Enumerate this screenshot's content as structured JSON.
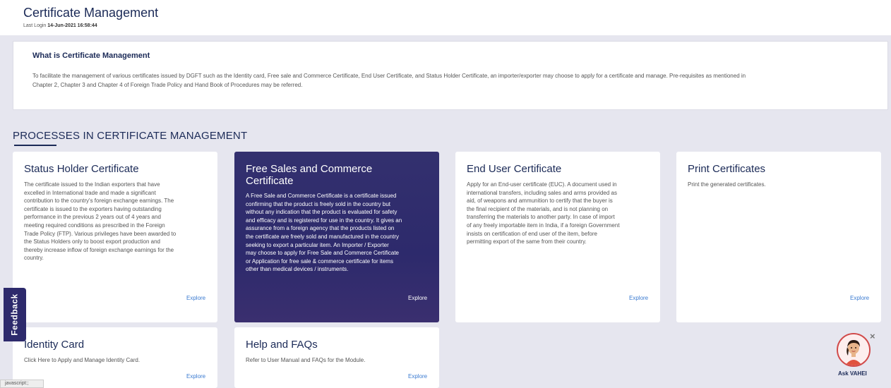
{
  "header": {
    "title": "Certificate Management",
    "last_login_label": "Last Login",
    "last_login_value": "14-Jun-2021 16:58:44"
  },
  "info": {
    "title": "What is Certificate Management",
    "text_line1": "To facilitate the management of various certificates issued by DGFT such as the Identity card, Free sale and Commerce Certificate, End User Certificate, and Status Holder Certificate, an importer/exporter may choose to apply for a certificate and manage. Pre-requisites as mentioned in",
    "text_line2": "Chapter 2, Chapter 3 and Chapter 4 of Foreign Trade Policy and Hand Book of Procedures may be referred."
  },
  "section": {
    "heading": "PROCESSES IN CERTIFICATE MANAGEMENT"
  },
  "cards": [
    {
      "title": "Status Holder Certificate",
      "lines": [
        "The certificate issued to the Indian exporters that have",
        "excelled in International trade and made a significant",
        "contribution to the country's foreign exchange earnings. The",
        "certificate is issued to the exporters having outstanding",
        "performance in the previous 2 years out of 4 years and",
        "meeting required conditions as prescribed in the Foreign",
        "Trade Policy (FTP). Various privileges have been awarded to",
        "the Status Holders only to boost export production and",
        "thereby increase inflow of foreign exchange earnings for the",
        "country."
      ],
      "explore": "Explore"
    },
    {
      "title_line1": "Free Sales and Commerce",
      "title_line2": "Certificate",
      "lines": [
        "A Free Sale and Commerce Certificate is a certificate issued",
        "confirming that the product is freely sold in the country but",
        "without any indication that the product is evaluated for safety",
        "and efficacy and is registered for use in the country. It gives an",
        "assurance from a foreign agency that the products listed on",
        "the certificate are freely sold and manufactured in the country",
        "seeking to export a particular item. An Importer / Exporter",
        "may choose to apply for Free Sale and Commerce Certificate",
        "or Application for free sale & commerce certificate for items",
        "other than medical devices / instruments."
      ],
      "explore": "Explore"
    },
    {
      "title": "End User Certificate",
      "lines": [
        "Apply for an End-user certificate (EUC). A document used in",
        "international transfers, including sales and arms provided as",
        "aid, of weapons and ammunition to certify that the buyer is",
        "the final recipient of the materials, and is not planning on",
        "transferring the materials to another party. In case of import",
        "of any freely importable item in India, if a foreign Government",
        "insists on certification of end user of the item, before",
        "permitting export of the same from their country."
      ],
      "explore": "Explore"
    },
    {
      "title": "Print Certificates",
      "lines": [
        "Print the generated certificates."
      ],
      "explore": "Explore"
    },
    {
      "title": "Identity Card",
      "lines": [
        "Click Here to Apply and Manage Identity Card."
      ],
      "explore": "Explore"
    },
    {
      "title": "Help and FAQs",
      "lines": [
        "Refer to User Manual and FAQs for the Module."
      ],
      "explore": "Explore"
    }
  ],
  "feedback": {
    "label": "Feedback"
  },
  "assistant": {
    "label": "Ask VAHEI",
    "close": "×"
  },
  "statusbar": {
    "text": "javascript:;"
  },
  "colors": {
    "accent": "#1b2a57",
    "card_dark": "#2d2a6c",
    "link": "#3b7bd1",
    "band": "#e6e6ef"
  }
}
